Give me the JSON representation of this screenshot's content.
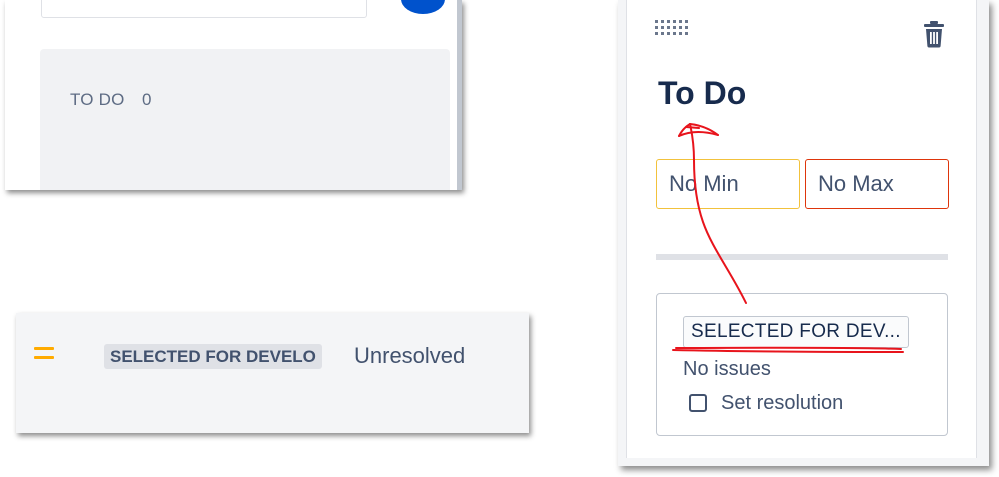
{
  "board_column": {
    "title": "TO DO",
    "count": "0"
  },
  "issue_row": {
    "priority_icon": "priority-medium-icon",
    "status": "SELECTED FOR DEVELO",
    "resolution": "Unresolved"
  },
  "column_config": {
    "name": "To Do",
    "min_placeholder": "No Min",
    "max_placeholder": "No Max",
    "status_chip": "SELECTED FOR DEV...",
    "issues_text": "No issues",
    "set_resolution_label": "Set resolution",
    "drag_icon": "drag-handle-icon",
    "delete_icon": "trash-icon"
  },
  "colors": {
    "priority": "#ffab00",
    "min_border": "#f2c23c",
    "max_border": "#de350b",
    "annotation": "#e8141c",
    "avatar": "#0052cc"
  }
}
